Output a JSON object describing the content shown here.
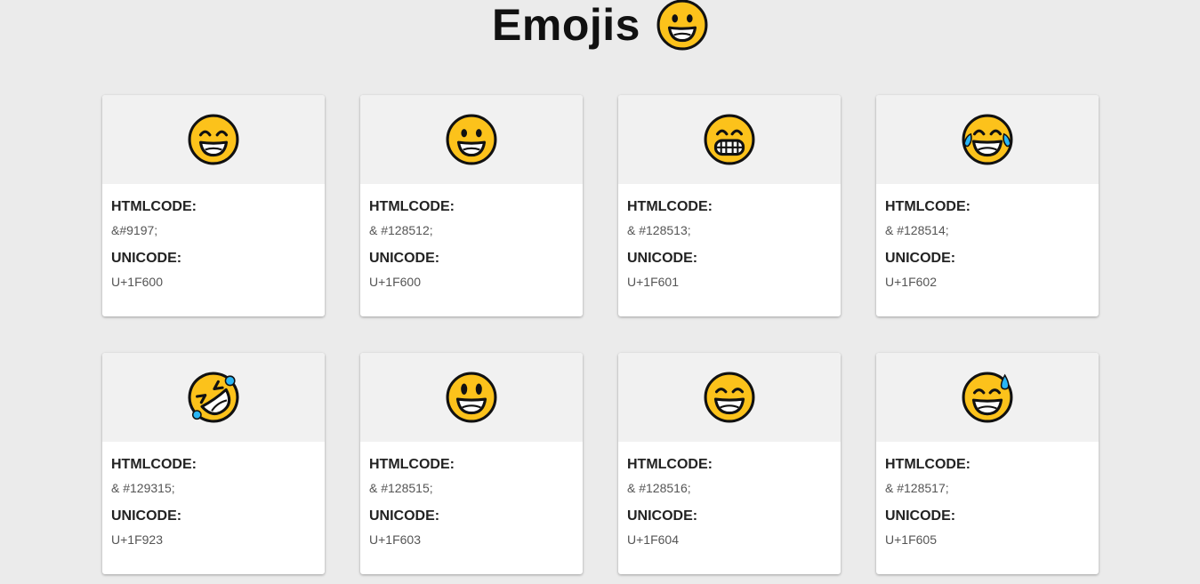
{
  "header": {
    "title": "Emojis",
    "title_icon": "grinning-face-icon"
  },
  "labels": {
    "htmlcode": "HTMLCODE:",
    "unicode": "UNICODE:"
  },
  "colors": {
    "background": "#ebebeb",
    "card_top": "#f1f1f1",
    "emoji_yellow": "#fcc21b",
    "tear_blue": "#29b6f6"
  },
  "cards": [
    {
      "icon": "smiling-face-with-smiling-eyes-icon",
      "htmlcode": "&#9197;",
      "unicode": "U+1F600"
    },
    {
      "icon": "grinning-face-icon",
      "htmlcode": "& #128512;",
      "unicode": "U+1F600"
    },
    {
      "icon": "grinning-face-with-teeth-icon",
      "htmlcode": "& #128513;",
      "unicode": "U+1F601"
    },
    {
      "icon": "face-with-tears-of-joy-icon",
      "htmlcode": "& #128514;",
      "unicode": "U+1F602"
    },
    {
      "icon": "rolling-on-the-floor-laughing-icon",
      "htmlcode": "& #129315;",
      "unicode": "U+1F923"
    },
    {
      "icon": "grinning-face-with-big-eyes-icon",
      "htmlcode": "& #128515;",
      "unicode": "U+1F603"
    },
    {
      "icon": "grinning-face-with-smiling-eyes-icon",
      "htmlcode": "& #128516;",
      "unicode": "U+1F604"
    },
    {
      "icon": "grinning-face-with-sweat-icon",
      "htmlcode": "& #128517;",
      "unicode": "U+1F605"
    }
  ]
}
